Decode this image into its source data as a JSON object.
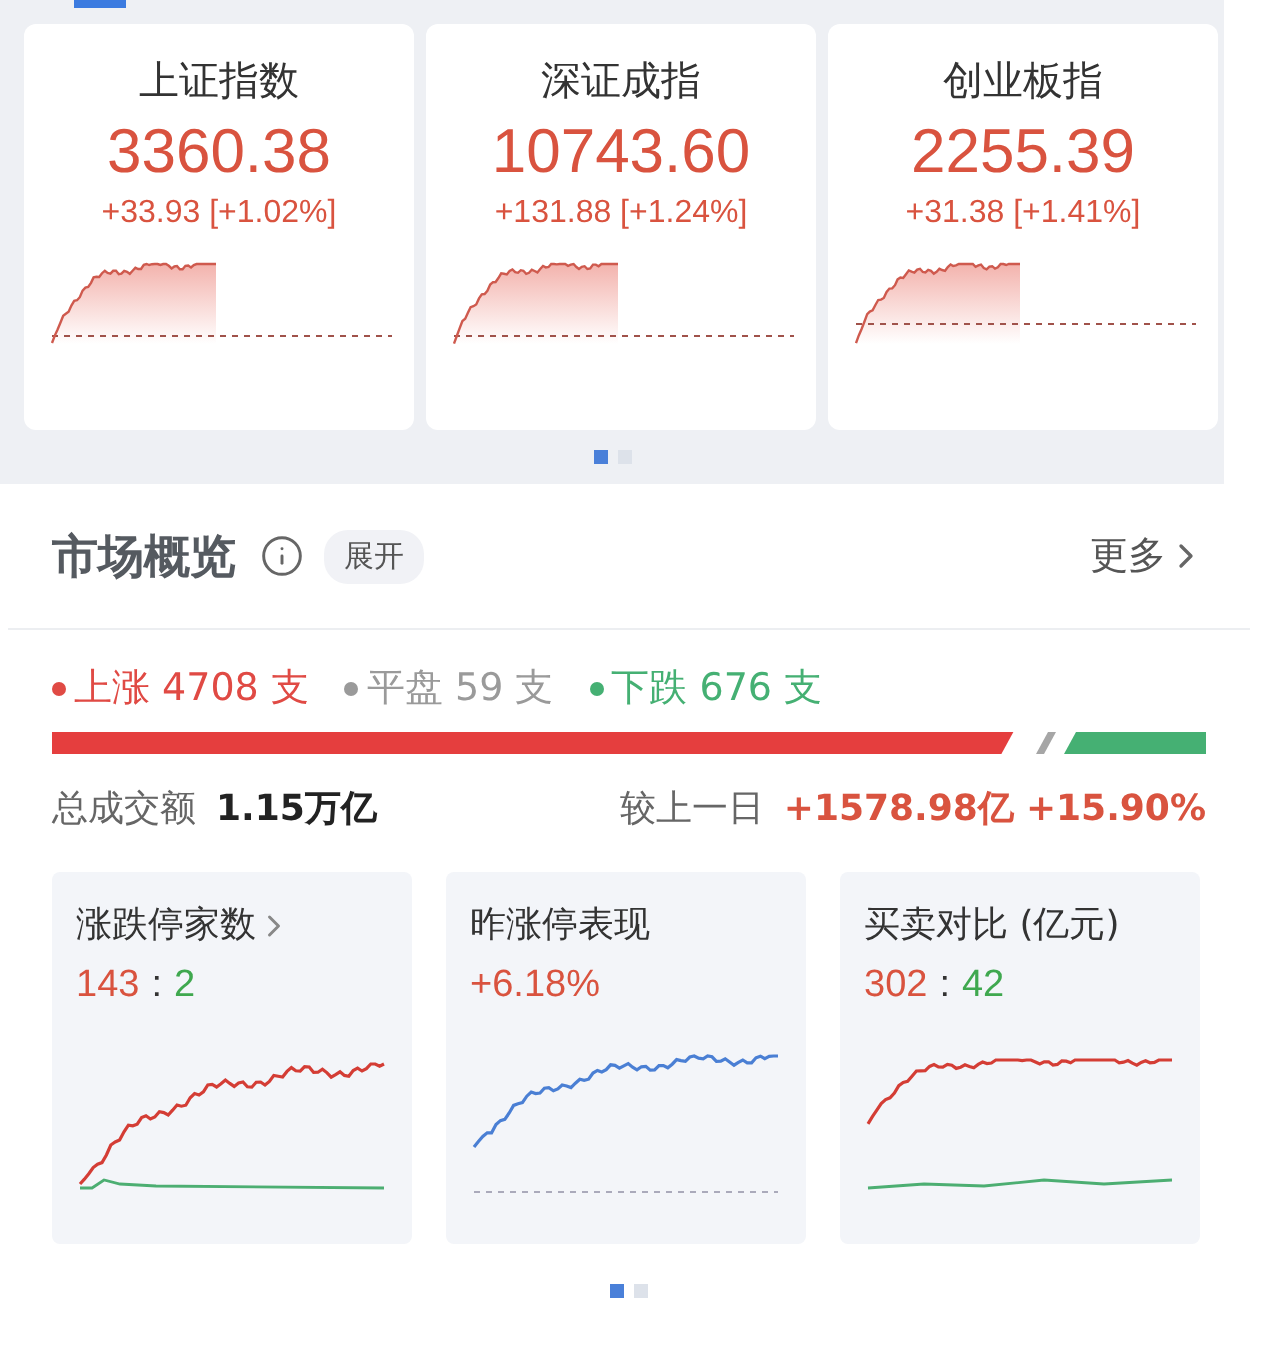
{
  "indices": [
    {
      "name": "上证指数",
      "value": "3360.38",
      "change": "+33.93 [+1.02%]"
    },
    {
      "name": "深证成指",
      "value": "10743.60",
      "change": "+131.88 [+1.24%]"
    },
    {
      "name": "创业板指",
      "value": "2255.39",
      "change": "+31.38 [+1.41%]"
    }
  ],
  "index_pager": [
    {
      "selected": true
    },
    {
      "selected": false
    }
  ],
  "market": {
    "title": "市场概览",
    "expand": "展开",
    "more": "更多",
    "counts": [
      {
        "text": "上涨 4708 支",
        "color": "#e04a44"
      },
      {
        "text": "平盘 59 支",
        "color": "#9a9a9a"
      },
      {
        "text": "下跌 676 支",
        "color": "#45b073"
      }
    ],
    "bar": [
      {
        "kind": "rise",
        "color": "#e53e3e"
      },
      {
        "kind": "flat",
        "color": "#a6a6a6"
      },
      {
        "kind": "fall",
        "color": "#45b073"
      }
    ],
    "turnover": {
      "label": "总成交额",
      "value": "1.15万亿",
      "compare_label": "较上一日",
      "delta": "+1578.98亿",
      "percent": "+15.90%"
    },
    "stats": [
      {
        "title": "涨跌停家数",
        "link": true,
        "figures": [
          {
            "text": "143",
            "color": "#d9533f"
          },
          {
            "text": ":",
            "color": "#333333"
          },
          {
            "text": "2",
            "color": "#3fa84f"
          }
        ]
      },
      {
        "title": "昨涨停表现",
        "link": false,
        "figures": [
          {
            "text": "+6.18%",
            "color": "#d9533f"
          }
        ]
      },
      {
        "title": "买卖对比 (亿元)",
        "link": false,
        "figures": [
          {
            "text": "302",
            "color": "#d9533f"
          },
          {
            "text": ":",
            "color": "#333333"
          },
          {
            "text": "42",
            "color": "#3fa84f"
          }
        ]
      }
    ],
    "pager": [
      {
        "selected": true
      },
      {
        "selected": false
      }
    ]
  }
}
